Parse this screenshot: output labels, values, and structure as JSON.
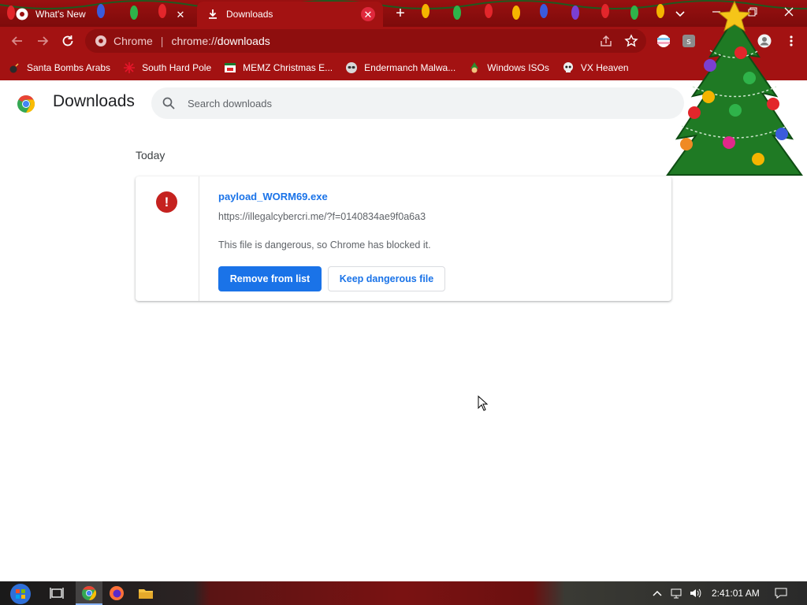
{
  "tabs": [
    {
      "title": "What's New",
      "active": false,
      "icon": "chrome-logo-icon",
      "close_glyph": "✕"
    },
    {
      "title": "Downloads",
      "active": true,
      "icon": "download-icon",
      "close_glyph": "✕"
    }
  ],
  "new_tab_glyph": "+",
  "toolbar": {
    "site_chip": "Chrome",
    "separator": "|",
    "url_scheme": "chrome://",
    "url_host": "downloads"
  },
  "bookmarks": [
    {
      "label": "Santa Bombs Arabs",
      "icon": "bomb-icon"
    },
    {
      "label": "South Hard Pole",
      "icon": "snowflake-icon"
    },
    {
      "label": "MEMZ Christmas E...",
      "icon": "window-icon"
    },
    {
      "label": "Endermanch Malwa...",
      "icon": "raccoon-icon"
    },
    {
      "label": "Windows ISOs",
      "icon": "elf-icon"
    },
    {
      "label": "VX Heaven",
      "icon": "skull-icon"
    }
  ],
  "page": {
    "title": "Downloads",
    "search_placeholder": "Search downloads",
    "section": "Today"
  },
  "download": {
    "file_name": "payload_WORM69.exe",
    "url": "https://illegalcybercri.me/?f=0140834ae9f0a6a3",
    "warning": "This file is dangerous, so Chrome has blocked it.",
    "warn_glyph": "!",
    "remove_label": "Remove from list",
    "keep_label": "Keep dangerous file"
  },
  "taskbar": {
    "clock": "2:41:01 AM"
  },
  "colors": {
    "accent": "#1a73e8",
    "danger": "#c5221f",
    "frame": "#a31212"
  }
}
